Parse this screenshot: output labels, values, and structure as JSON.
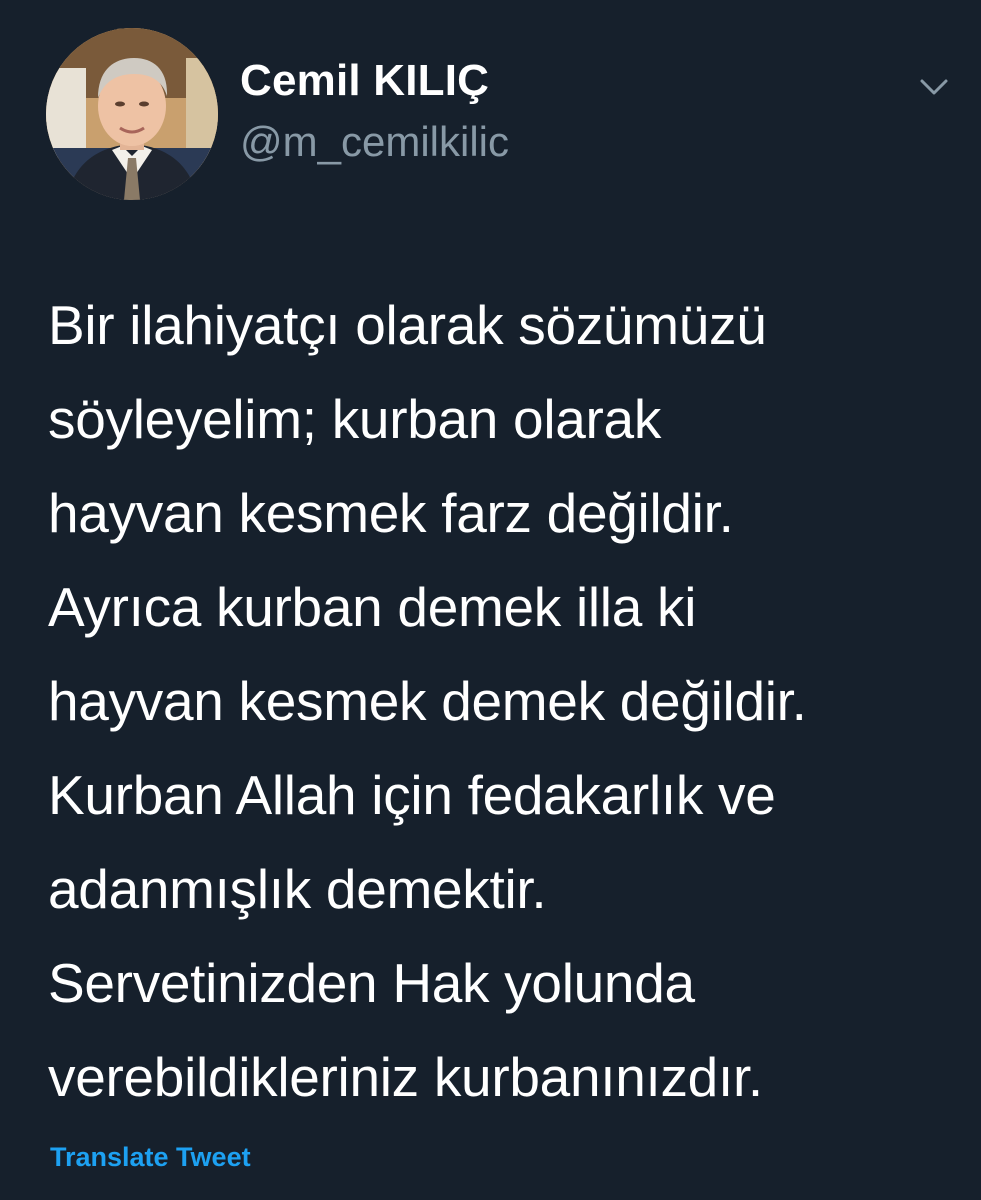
{
  "author": {
    "display_name": "Cemil KILIÇ",
    "handle": "@m_cemilkilic"
  },
  "tweet": {
    "lines": [
      "Bir ilahiyatçı olarak sözümüzü",
      "söyleyelim; kurban olarak",
      "hayvan kesmek farz değildir.",
      "Ayrıca kurban demek illa ki",
      "hayvan kesmek demek değildir.",
      "Kurban Allah için fedakarlık ve",
      "adanmışlık demektir.",
      "Servetinizden Hak yolunda",
      "verebildikleriniz kurbanınızdır."
    ]
  },
  "actions": {
    "translate_label": "Translate Tweet"
  },
  "icons": {
    "menu": "chevron-down-icon",
    "avatar": "profile-photo"
  },
  "colors": {
    "background": "#16202c",
    "text": "#ffffff",
    "secondary_text": "#8899a6",
    "link": "#1da1f2"
  }
}
